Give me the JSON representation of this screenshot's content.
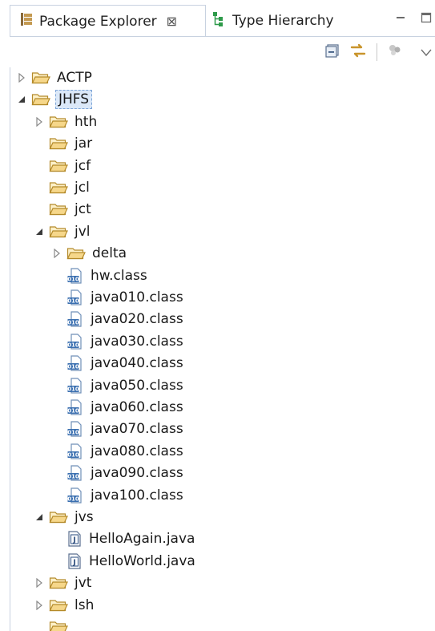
{
  "tabs": [
    {
      "label": "Package Explorer",
      "icon": "package-explorer-icon",
      "active": true,
      "close": "⊠"
    },
    {
      "label": "Type Hierarchy",
      "icon": "type-hierarchy-icon",
      "active": false
    }
  ],
  "tree": [
    {
      "label": "ACTP",
      "type": "folder",
      "level": 0,
      "expander": "collapsed"
    },
    {
      "label": "JHFS",
      "type": "folder",
      "level": 0,
      "expander": "expanded",
      "selected": true
    },
    {
      "label": "hth",
      "type": "folder",
      "level": 1,
      "expander": "collapsed"
    },
    {
      "label": "jar",
      "type": "folder",
      "level": 1,
      "expander": "none"
    },
    {
      "label": "jcf",
      "type": "folder",
      "level": 1,
      "expander": "none"
    },
    {
      "label": "jcl",
      "type": "folder",
      "level": 1,
      "expander": "none"
    },
    {
      "label": "jct",
      "type": "folder",
      "level": 1,
      "expander": "none"
    },
    {
      "label": "jvl",
      "type": "folder",
      "level": 1,
      "expander": "expanded"
    },
    {
      "label": "delta",
      "type": "folder",
      "level": 2,
      "expander": "collapsed"
    },
    {
      "label": "hw.class",
      "type": "class",
      "level": 2,
      "expander": "none"
    },
    {
      "label": "java010.class",
      "type": "class",
      "level": 2,
      "expander": "none"
    },
    {
      "label": "java020.class",
      "type": "class",
      "level": 2,
      "expander": "none"
    },
    {
      "label": "java030.class",
      "type": "class",
      "level": 2,
      "expander": "none"
    },
    {
      "label": "java040.class",
      "type": "class",
      "level": 2,
      "expander": "none"
    },
    {
      "label": "java050.class",
      "type": "class",
      "level": 2,
      "expander": "none"
    },
    {
      "label": "java060.class",
      "type": "class",
      "level": 2,
      "expander": "none"
    },
    {
      "label": "java070.class",
      "type": "class",
      "level": 2,
      "expander": "none"
    },
    {
      "label": "java080.class",
      "type": "class",
      "level": 2,
      "expander": "none"
    },
    {
      "label": "java090.class",
      "type": "class",
      "level": 2,
      "expander": "none"
    },
    {
      "label": "java100.class",
      "type": "class",
      "level": 2,
      "expander": "none"
    },
    {
      "label": "jvs",
      "type": "folder",
      "level": 1,
      "expander": "expanded"
    },
    {
      "label": "HelloAgain.java",
      "type": "java",
      "level": 2,
      "expander": "none"
    },
    {
      "label": "HelloWorld.java",
      "type": "java",
      "level": 2,
      "expander": "none"
    },
    {
      "label": "jvt",
      "type": "folder",
      "level": 1,
      "expander": "collapsed"
    },
    {
      "label": "lsh",
      "type": "folder",
      "level": 1,
      "expander": "collapsed"
    }
  ],
  "toolbar": {
    "icons": [
      "collapse-all-icon",
      "link-with-editor-icon",
      "focus-active-task-icon",
      "view-menu-icon"
    ]
  },
  "window_buttons": [
    "minimize-icon",
    "maximize-icon"
  ],
  "colors": {
    "folder_fill": "#f6d78a",
    "folder_stroke": "#b48a2a",
    "class_blue": "#3a6fb0",
    "selection": "#dbe8f8",
    "tab_border": "#c8d2e0"
  }
}
